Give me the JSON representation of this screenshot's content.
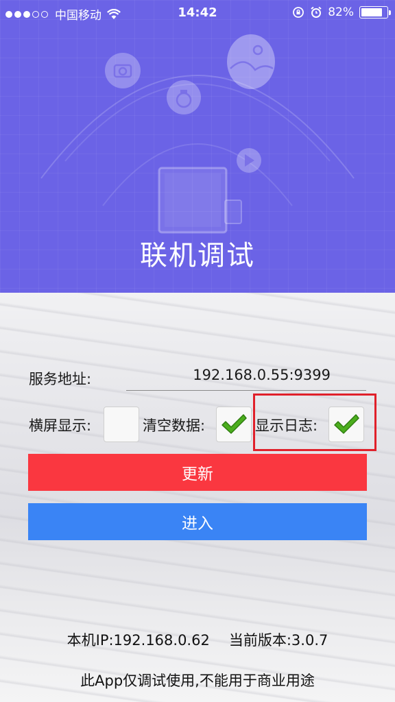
{
  "status_bar": {
    "carrier": "中国移动",
    "time": "14:42",
    "battery": "82%",
    "battery_level": 0.82
  },
  "header": {
    "title": "联机调试"
  },
  "form": {
    "server_label": "服务地址:",
    "server_value": "192.168.0.55:9399",
    "landscape_label": "横屏显示:",
    "landscape_checked": false,
    "clear_label": "清空数据:",
    "clear_checked": true,
    "log_label": "显示日志:",
    "log_checked": true
  },
  "buttons": {
    "update_label": "更新",
    "enter_label": "进入"
  },
  "colors": {
    "header_bg": "#6b63e6",
    "update_button": "#fa3740",
    "enter_button": "#3a84f5",
    "highlight": "#e0202a",
    "check_green": "#4cae1e"
  },
  "footer": {
    "local_ip": "本机IP:192.168.0.62",
    "version": "当前版本:3.0.7",
    "note": "此App仅调试使用,不能用于商业用途"
  }
}
